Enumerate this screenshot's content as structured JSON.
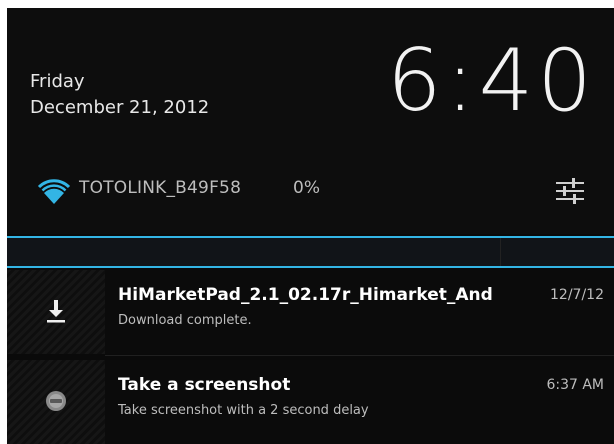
{
  "header": {
    "day": "Friday",
    "date": "December 21, 2012",
    "time": "6:40"
  },
  "wifi": {
    "ssid": "TOTOLINK_B49F58",
    "percent": "0%",
    "icon": "wifi-icon"
  },
  "settings": {
    "icon": "settings-sliders-icon"
  },
  "notifications": [
    {
      "icon": "download-icon",
      "title": "HiMarketPad_2.1_02.17r_Himarket_And",
      "text": "Download complete.",
      "time": "12/7/12"
    },
    {
      "icon": "screenshot-icon",
      "title": "Take a screenshot",
      "text": "Take screenshot with a 2 second delay",
      "time": "6:37 AM"
    }
  ],
  "colors": {
    "accent": "#33b5e5",
    "background": "#0a0a0a",
    "text_primary": "#ffffff",
    "text_secondary": "#bdbdbd"
  }
}
